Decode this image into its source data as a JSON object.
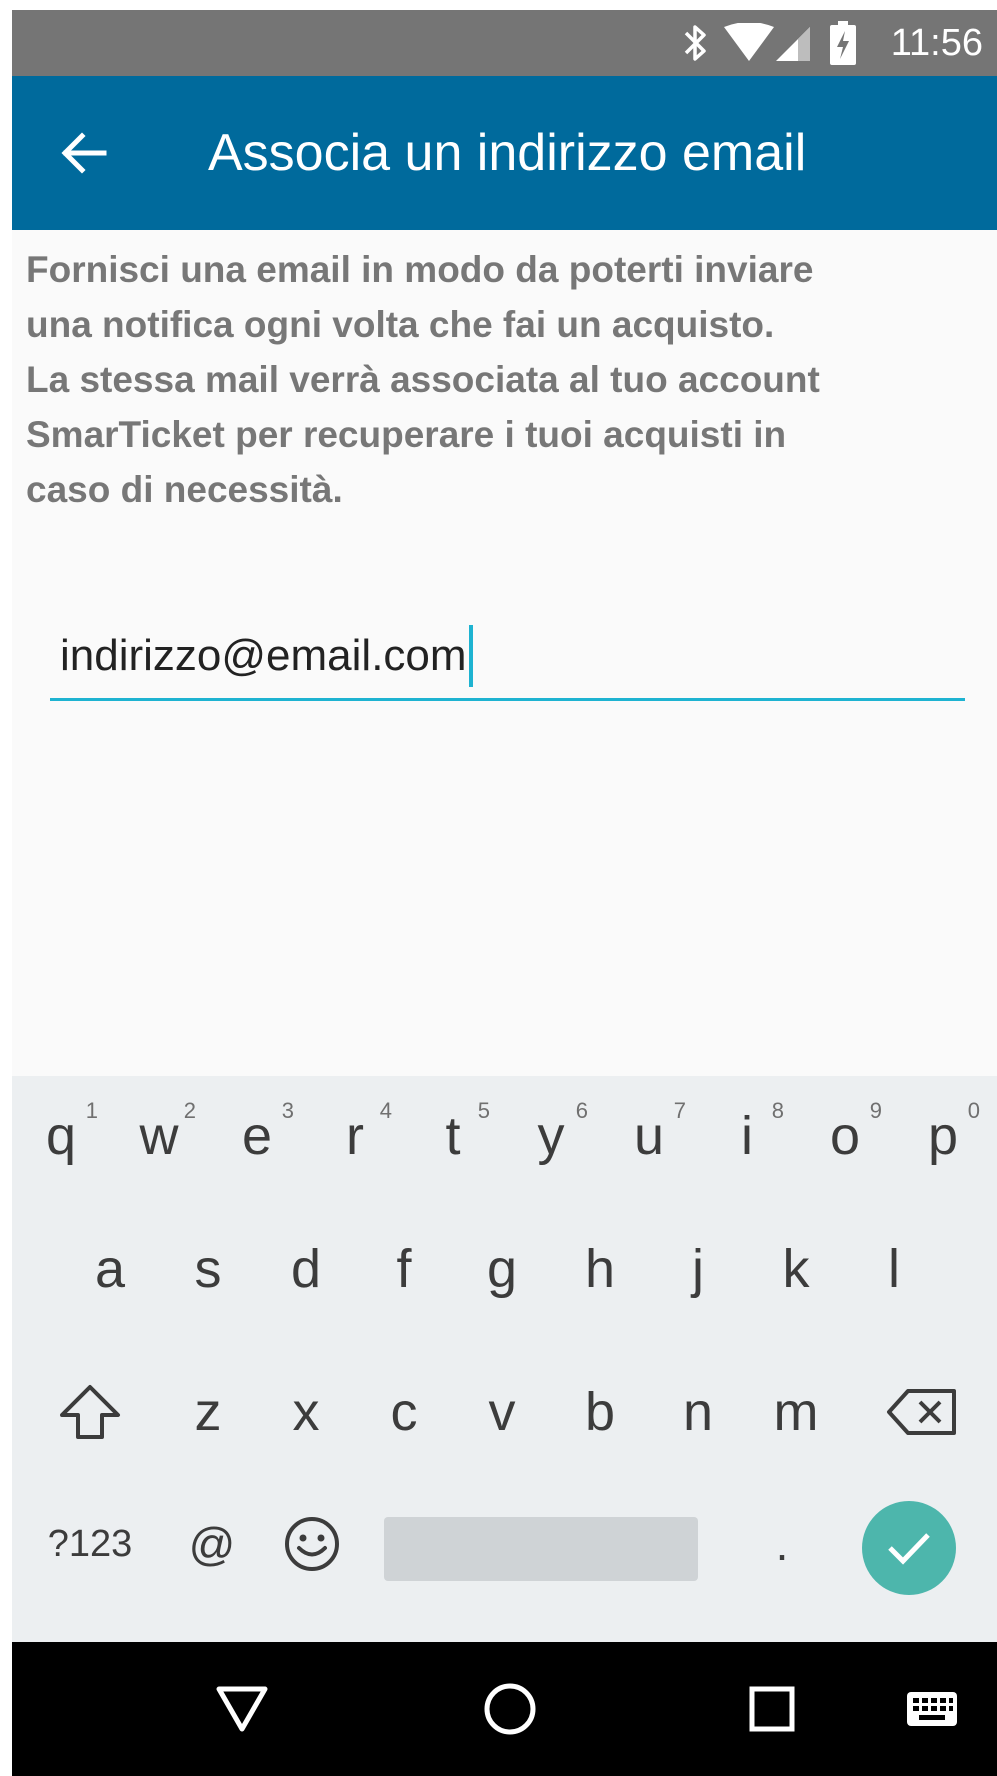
{
  "status_bar": {
    "time": "11:56",
    "icons": [
      "bluetooth-icon",
      "wifi-icon",
      "cell-signal-icon",
      "battery-charging-icon"
    ]
  },
  "app_bar": {
    "title": "Associa un indirizzo email",
    "back_icon": "arrow-left-icon"
  },
  "description": {
    "lines": [
      "Fornisci una email in modo da poterti inviare",
      "una notifica ogni volta che fai un acquisto.",
      "La stessa mail verrà associata al tuo account",
      "SmarTicket per recuperare i tuoi acquisti in",
      "caso di necessità."
    ]
  },
  "email_input": {
    "value": "indirizzo@email.com"
  },
  "keyboard": {
    "row1": [
      {
        "key": "q",
        "hint": "1"
      },
      {
        "key": "w",
        "hint": "2"
      },
      {
        "key": "e",
        "hint": "3"
      },
      {
        "key": "r",
        "hint": "4"
      },
      {
        "key": "t",
        "hint": "5"
      },
      {
        "key": "y",
        "hint": "6"
      },
      {
        "key": "u",
        "hint": "7"
      },
      {
        "key": "i",
        "hint": "8"
      },
      {
        "key": "o",
        "hint": "9"
      },
      {
        "key": "p",
        "hint": "0"
      }
    ],
    "row2": [
      "a",
      "s",
      "d",
      "f",
      "g",
      "h",
      "j",
      "k",
      "l"
    ],
    "row3": [
      "z",
      "x",
      "c",
      "v",
      "b",
      "n",
      "m"
    ],
    "row4": {
      "symbols_label": "?123",
      "at_label": "@",
      "period_label": "."
    },
    "accent_color": "#4db6ac",
    "special_icons": [
      "shift-icon",
      "backspace-icon",
      "emoji-icon",
      "checkmark-icon"
    ]
  },
  "nav_bar": {
    "icons": [
      "back-triangle-icon",
      "home-circle-icon",
      "recents-square-icon",
      "keyboard-switch-icon"
    ]
  },
  "colors": {
    "status_bar": "#757575",
    "app_bar": "#006a9c",
    "input_underline": "#1eb3d1",
    "description_text": "#777777"
  }
}
